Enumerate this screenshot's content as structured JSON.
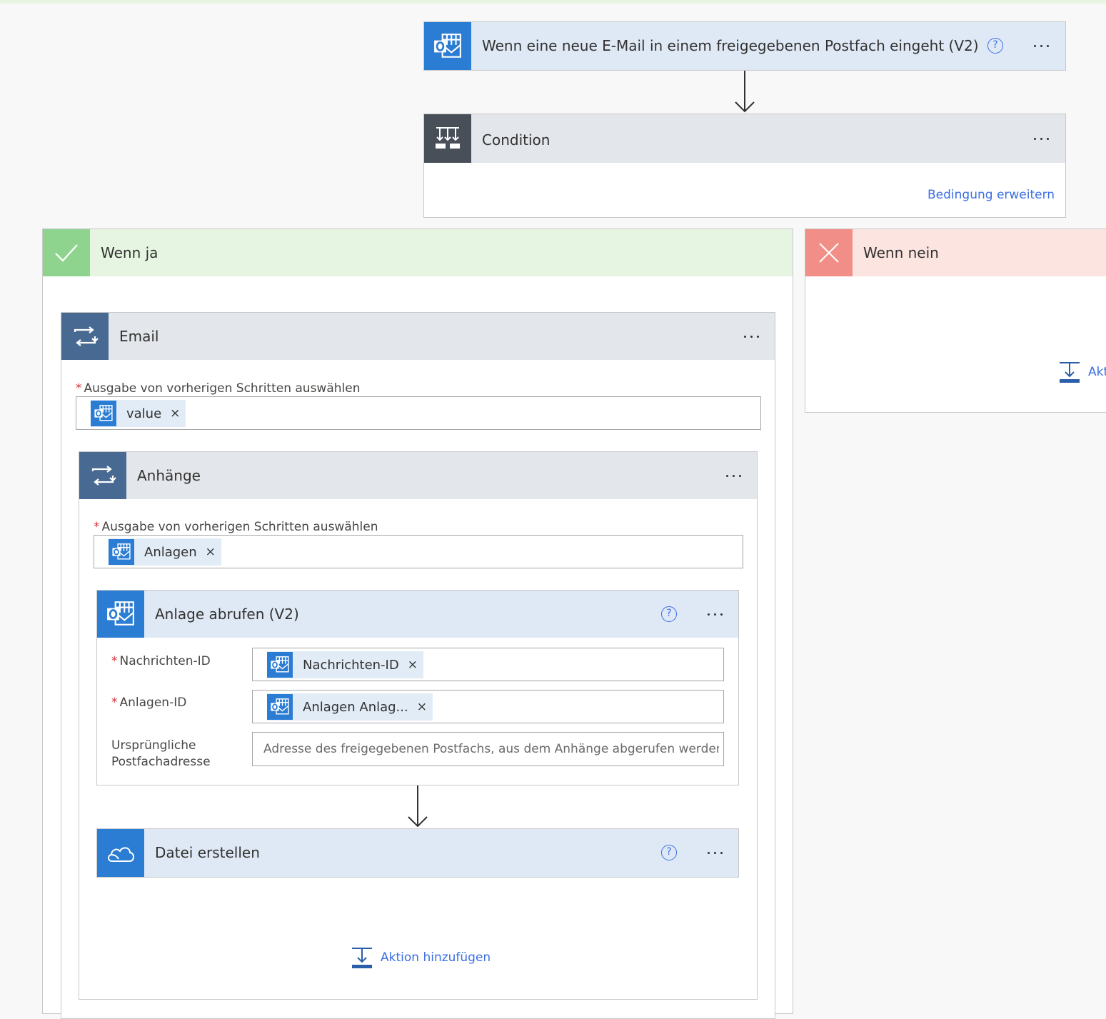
{
  "trigger": {
    "title": "Wenn eine neue E-Mail in einem freigegebenen Postfach eingeht (V2)",
    "help": "?"
  },
  "condition": {
    "title": "Condition",
    "expand_link": "Bedingung erweitern"
  },
  "yes_branch": {
    "title": "Wenn ja"
  },
  "no_branch": {
    "title": "Wenn nein",
    "add_action_partial": "Akt"
  },
  "email_loop": {
    "title": "Email",
    "field_label": "Ausgabe von vorherigen Schritten auswählen",
    "token": "value",
    "token_remove": "×"
  },
  "attachments_loop": {
    "title": "Anhänge",
    "field_label": "Ausgabe von vorherigen Schritten auswählen",
    "token": "Anlagen",
    "token_remove": "×"
  },
  "get_attachment": {
    "title": "Anlage abrufen (V2)",
    "help": "?",
    "fields": {
      "message_id_label": "Nachrichten-ID",
      "message_id_token": "Nachrichten-ID",
      "attachment_id_label": "Anlagen-ID",
      "attachment_id_token": "Anlagen Anlag...",
      "mailbox_label_line1": "Ursprüngliche",
      "mailbox_label_line2": "Postfachadresse",
      "mailbox_placeholder": "Adresse des freigegebenen Postfachs, aus dem Anhänge abgerufen werden sol..."
    },
    "token_remove": "×"
  },
  "create_file": {
    "title": "Datei erstellen",
    "help": "?"
  },
  "add_action": {
    "label": "Aktion hinzufügen"
  },
  "colors": {
    "accent_blue": "#3b6ee3",
    "outlook_blue": "#2b7cd3",
    "loop_slate": "#486991",
    "condition_dark": "#484f58",
    "yes_green": "#8fd48e",
    "no_red": "#f08e87"
  },
  "icons": {
    "trigger": "outlook-icon",
    "condition": "condition-icon",
    "yes": "checkmark-icon",
    "no": "close-icon",
    "loop": "loop-icon",
    "onedrive": "onedrive-icon",
    "add": "add-action-icon"
  }
}
